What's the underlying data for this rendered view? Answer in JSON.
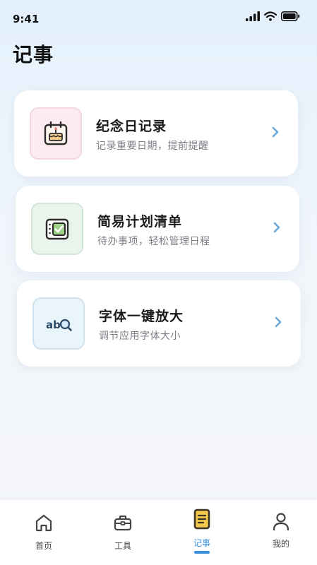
{
  "status_bar": {
    "time": "9:41"
  },
  "header": {
    "title": "记事"
  },
  "cards": [
    {
      "title": "纪念日记录",
      "subtitle": "记录重要日期，提前提醒",
      "icon": "calendar-cake-icon",
      "tint": "#fcecef"
    },
    {
      "title": "简易计划清单",
      "subtitle": "待办事项，轻松管理日程",
      "icon": "checklist-icon",
      "tint": "#e8f4ec"
    },
    {
      "title": "字体一键放大",
      "subtitle": "调节应用字体大小",
      "icon": "text-magnify-icon",
      "tint": "#e9f4fb"
    }
  ],
  "bottom_nav": {
    "items": [
      {
        "label": "首页",
        "icon": "home-icon",
        "active": false
      },
      {
        "label": "工具",
        "icon": "toolbox-icon",
        "active": false
      },
      {
        "label": "记事",
        "icon": "notebook-icon",
        "active": true
      },
      {
        "label": "我的",
        "icon": "person-icon",
        "active": false
      }
    ]
  },
  "colors": {
    "accent": "#3a8fd8",
    "chevron": "#6aa8d8",
    "active_icon": "#3a3222",
    "active_icon_fill": "#f2c94c"
  }
}
